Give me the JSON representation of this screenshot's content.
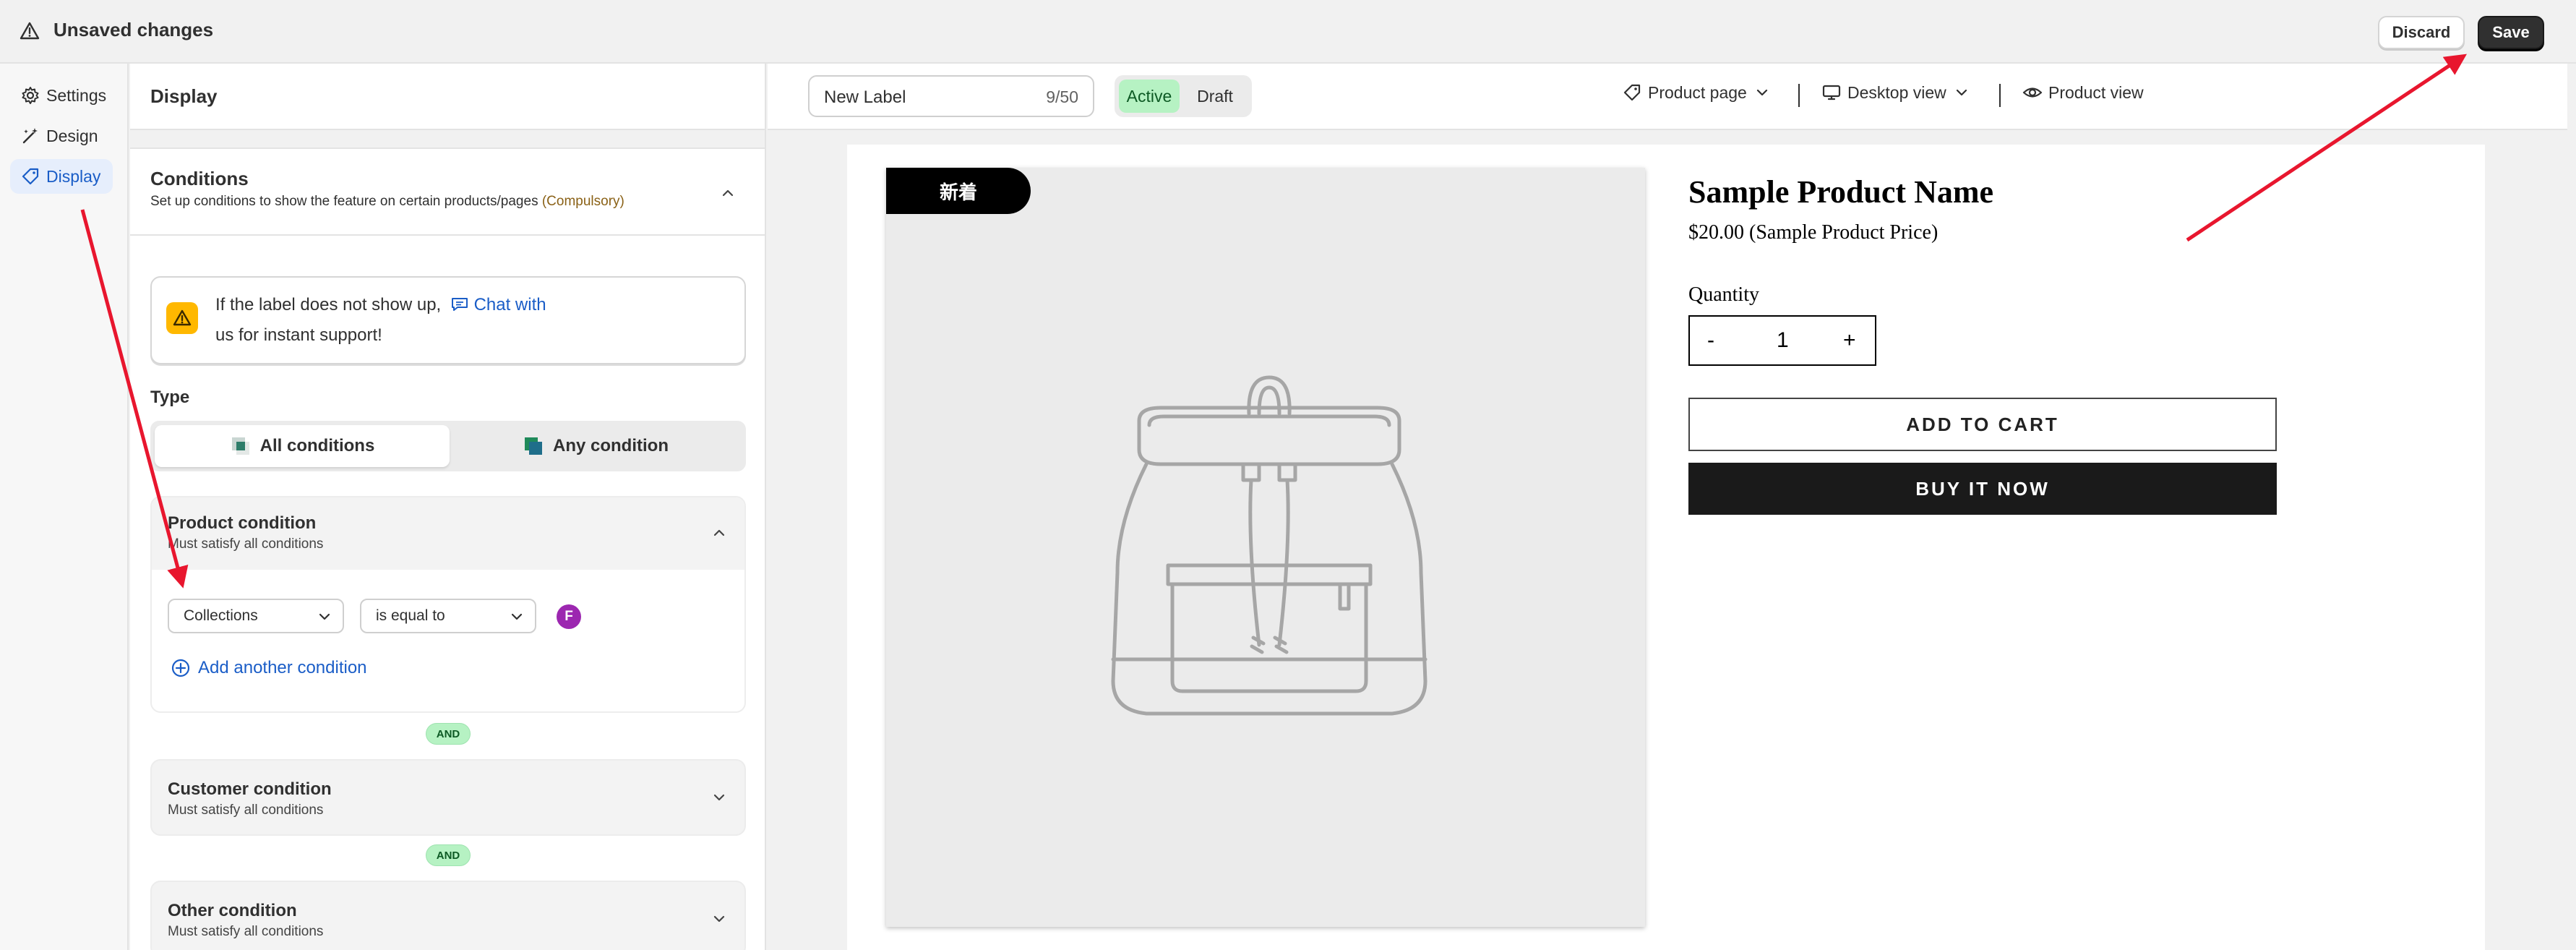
{
  "topbar": {
    "title": "Unsaved changes",
    "icon": "warning-triangle-icon",
    "discard_label": "Discard",
    "save_label": "Save"
  },
  "leftnav": {
    "items": [
      {
        "label": "Settings",
        "icon": "gear-icon",
        "active": false
      },
      {
        "label": "Design",
        "icon": "magic-wand-icon",
        "active": false
      },
      {
        "label": "Display",
        "icon": "tag-icon",
        "active": true
      }
    ]
  },
  "panel": {
    "title": "Display",
    "conditions": {
      "title": "Conditions",
      "subtitle": "Set up conditions to show the feature on certain products/pages",
      "compulsory": "(Compulsory)"
    },
    "notice": {
      "line1_prefix": "If the label does not show up,",
      "chat_link": "Chat with",
      "line2": "us for instant support!"
    },
    "type": {
      "label": "Type",
      "options": [
        "All conditions",
        "Any condition"
      ],
      "selected": "All conditions"
    },
    "product_condition": {
      "title": "Product condition",
      "subtitle": "Must satisfy all conditions",
      "field": "Collections",
      "operator": "is equal to",
      "value_avatar": "F",
      "add_label": "Add another condition"
    },
    "and_label": "AND",
    "customer_condition": {
      "title": "Customer condition",
      "subtitle": "Must satisfy all conditions"
    },
    "other_condition": {
      "title": "Other condition",
      "subtitle": "Must satisfy all conditions"
    }
  },
  "preview": {
    "label_name": "New Label",
    "char_count": "9/50",
    "status_active": "Active",
    "status_draft": "Draft",
    "page_select": "Product page",
    "view_select": "Desktop view",
    "product_view": "Product view",
    "tag_text": "新着",
    "product": {
      "name": "Sample Product Name",
      "price": "$20.00 (Sample Product Price)",
      "quantity_label": "Quantity",
      "quantity_minus": "-",
      "quantity_value": "1",
      "quantity_plus": "+",
      "add_to_cart": "ADD TO CART",
      "buy_now": "BUY IT NOW"
    }
  },
  "colors": {
    "accent_blue": "#1a5dc7",
    "active_green": "#b6f2c3",
    "annotation_red": "#e8162e",
    "save_dark": "#303030"
  }
}
